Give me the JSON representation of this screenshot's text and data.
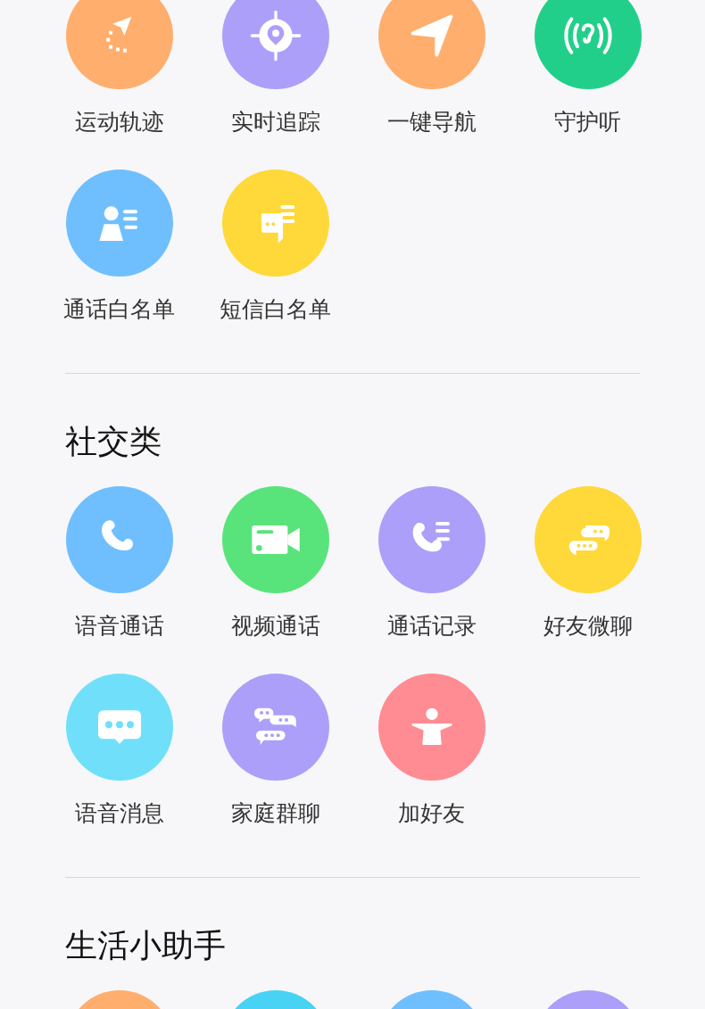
{
  "sections": [
    {
      "items": [
        {
          "label": "运动轨迹",
          "kind": "track",
          "color": "#ffae6e"
        },
        {
          "label": "实时追踪",
          "kind": "locate",
          "color": "#ac9ffa"
        },
        {
          "label": "一键导航",
          "kind": "navigate",
          "color": "#ffae6e"
        },
        {
          "label": "守护听",
          "kind": "listen",
          "color": "#22cf8a"
        },
        {
          "label": "通话白名单",
          "kind": "contacts",
          "color": "#6fbfff"
        },
        {
          "label": "短信白名单",
          "kind": "sms",
          "color": "#ffd83a"
        }
      ]
    },
    {
      "title": "社交类",
      "items": [
        {
          "label": "语音通话",
          "kind": "phone",
          "color": "#6fbfff"
        },
        {
          "label": "视频通话",
          "kind": "video",
          "color": "#58e47a"
        },
        {
          "label": "通话记录",
          "kind": "calllog",
          "color": "#ac9ffa"
        },
        {
          "label": "好友微聊",
          "kind": "chat",
          "color": "#ffd83a"
        },
        {
          "label": "语音消息",
          "kind": "voice",
          "color": "#70e0fa"
        },
        {
          "label": "家庭群聊",
          "kind": "group",
          "color": "#ac9ffa"
        },
        {
          "label": "加好友",
          "kind": "addfriend",
          "color": "#ff8c92"
        }
      ]
    },
    {
      "title": "生活小助手",
      "items": [
        {
          "kind": "blank",
          "color": "#ffae6e"
        },
        {
          "kind": "blank",
          "color": "#48d2f4"
        },
        {
          "kind": "blank",
          "color": "#6fbfff"
        },
        {
          "kind": "blank",
          "color": "#ac9ffa"
        }
      ]
    }
  ]
}
